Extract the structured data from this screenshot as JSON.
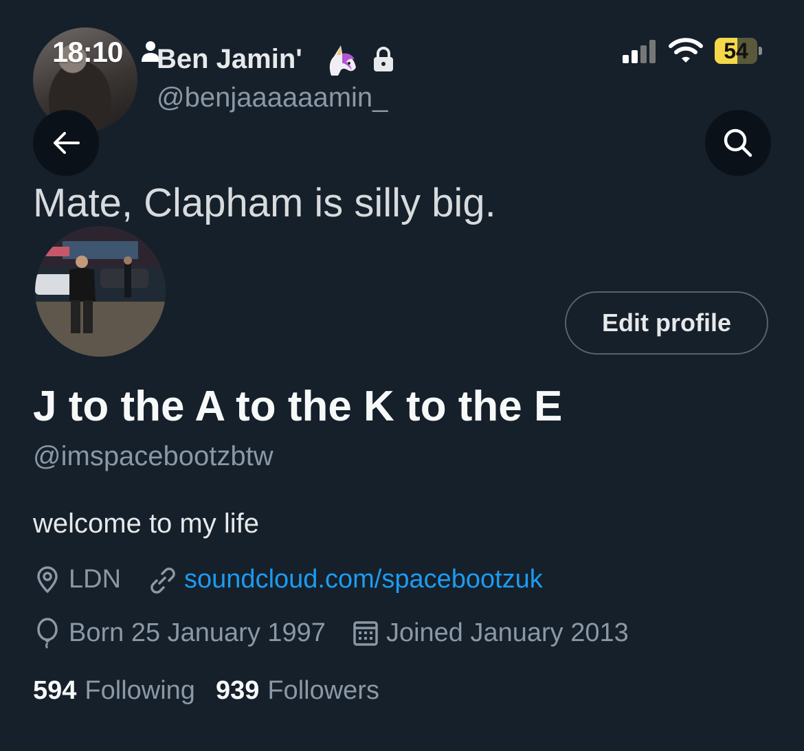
{
  "status_bar": {
    "time": "18:10",
    "battery_level": "54",
    "battery_fraction": 0.54
  },
  "header": {
    "name": "Ben Jamin'",
    "name_emoji": "unicorn-icon",
    "locked": true,
    "handle": "@benjaaaaaamin_"
  },
  "banner_text": "Mate, Clapham is silly big.",
  "actions": {
    "back": "arrow-left-icon",
    "search": "search-icon",
    "edit_profile": "Edit profile"
  },
  "profile": {
    "display_name": "J to the A to the K to the E",
    "handle": "@imspacebootzbtw",
    "bio": "welcome to my life",
    "location": "LDN",
    "website": "soundcloud.com/spacebootzuk",
    "born": "Born 25 January 1997",
    "joined": "Joined January 2013"
  },
  "stats": {
    "following_count": "594",
    "following_label": "Following",
    "followers_count": "939",
    "followers_label": "Followers"
  },
  "colors": {
    "background": "#15202b",
    "accent_link": "#1d9bf0",
    "secondary_text": "#8b98a5",
    "battery": "#f4d84a"
  }
}
